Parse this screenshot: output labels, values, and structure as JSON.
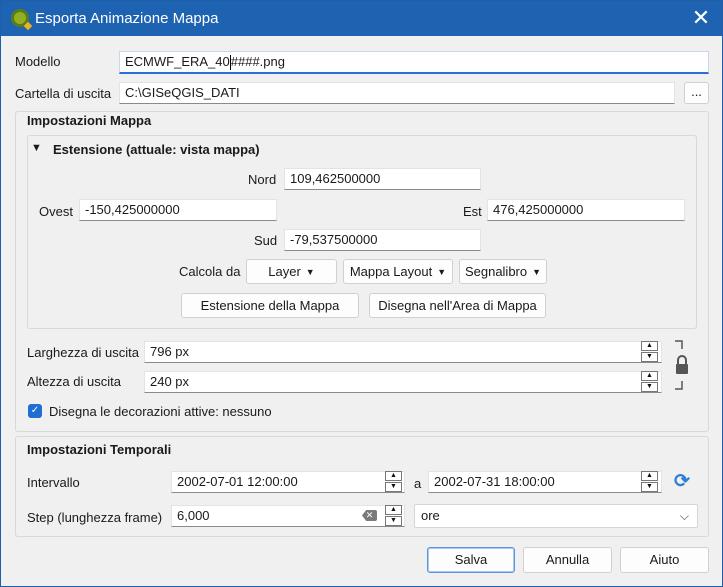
{
  "titlebar": {
    "title": "Esporta Animazione Mappa",
    "close_glyph": "✕",
    "app_icon": "qgis-logo-icon"
  },
  "template": {
    "label": "Modello",
    "value_before_caret": "ECMWF_ERA_40",
    "value_after_caret": "####.png"
  },
  "output_folder": {
    "label": "Cartella di uscita",
    "value": "C:\\GISeQGIS_DATI",
    "browse_label": "..."
  },
  "map_settings": {
    "title": "Impostazioni Mappa",
    "extent": {
      "title": "Estensione (attuale: vista mappa)",
      "collapse_glyph": "▼",
      "north_label": "Nord",
      "north_value": "109,462500000",
      "west_label": "Ovest",
      "west_value": "-150,425000000",
      "east_label": "Est",
      "east_value": "476,425000000",
      "south_label": "Sud",
      "south_value": "-79,537500000",
      "calc_from_label": "Calcola da",
      "layer_button": "Layer",
      "layout_button": "Mappa Layout",
      "bookmark_button": "Segnalibro",
      "map_extent_button": "Estensione della Mappa",
      "draw_button": "Disegna nell'Area di Mappa",
      "dropdown_glyph": "▼"
    },
    "width_label": "Larghezza di uscita",
    "width_value": "796 px",
    "height_label": "Altezza di uscita",
    "height_value": "240 px",
    "decorations_label": "Disegna le decorazioni attive: nessuno",
    "decorations_checked": true
  },
  "temporal_settings": {
    "title": "Impostazioni Temporali",
    "interval_label": "Intervallo",
    "start_value": "2002-07-01 12:00:00",
    "to_label": "a",
    "end_value": "2002-07-31 18:00:00",
    "step_label": "Step (lunghezza frame)",
    "step_value": "6,000",
    "unit_value": "ore"
  },
  "buttons": {
    "save": "Salva",
    "cancel": "Annulla",
    "help": "Aiuto"
  },
  "colors": {
    "titlebar": "#1e63b2",
    "accent": "#2b6ed6",
    "checkbox": "#1e6fd0"
  }
}
